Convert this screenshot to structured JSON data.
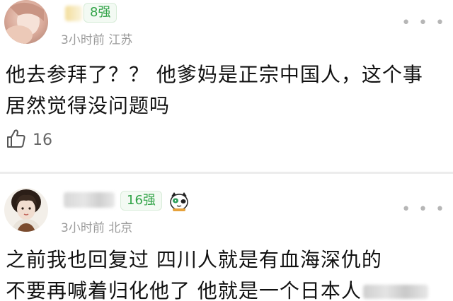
{
  "comments": [
    {
      "badge": "8强",
      "time": "3小时前",
      "location": "江苏",
      "lines": [
        "他去参拜了？？ 他爹妈是正宗中国人，这个事",
        "居然觉得没问题吗"
      ],
      "like_count": "16",
      "icons": [
        "avatar",
        "more-icon",
        "thumbs-up-icon"
      ]
    },
    {
      "badge": "16强",
      "time": "3小时前",
      "location": "北京",
      "lines": [
        "之前我也回复过 四川人就是有血海深仇的",
        "不要再喊着归化他了 他就是一个日本人"
      ],
      "icons": [
        "avatar",
        "cat-sticker-icon",
        "more-icon"
      ]
    }
  ],
  "colors": {
    "badge_text": "#31a347",
    "badge_border": "#d8ecd9",
    "meta_text": "#9a9a9a",
    "body_text": "#111111"
  }
}
